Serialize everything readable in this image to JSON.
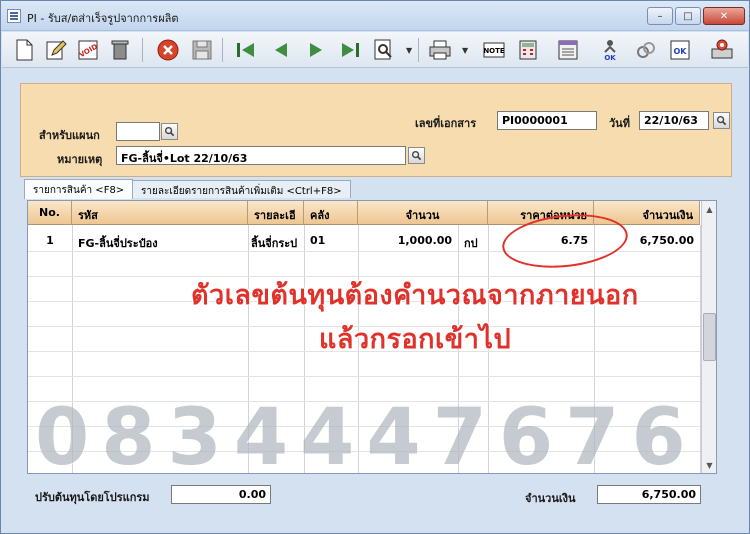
{
  "window": {
    "title": "PI - รับส/ตส่าเร็จรูปจากการผลิต",
    "min_label": "–",
    "max_label": "□",
    "close_label": "✕"
  },
  "toolbar": {
    "icons": [
      "new-icon",
      "edit-icon",
      "void-icon",
      "delete-icon",
      "cancel-icon",
      "save-icon",
      "first-icon",
      "prev-icon",
      "next-icon",
      "last-icon",
      "search-icon",
      "print-icon",
      "note-icon",
      "calculator-icon",
      "report-icon",
      "approve-ok-icon",
      "unlink-icon",
      "ok-icon",
      "settings-icon"
    ]
  },
  "form": {
    "department_label": "สำหรับแผนก",
    "department_value": "",
    "doc_no_label": "เลขที่เอกสาร",
    "doc_no_value": "PI0000001",
    "date_label": "วันที่",
    "date_value": "22/10/63",
    "remark_label": "หมายเหตุ",
    "remark_value": "FG-ลิ้นจี่•Lot 22/10/63"
  },
  "tabs": [
    {
      "label": "รายการสินค้า <F8>",
      "active": true
    },
    {
      "label": "รายละเอียดรายการสินค้าเพิ่มเติม <Ctrl+F8>",
      "active": false
    }
  ],
  "grid": {
    "columns": [
      "No.",
      "รหัส",
      "รายละเอี",
      "คลัง",
      "จำนวน",
      "ราคาต่อหน่วย",
      "จำนวนเงิน"
    ],
    "rows": [
      {
        "no": "1",
        "code": "FG-ลิ้นจี่ประป๋อง",
        "desc": "ลิ้นจี่กระป",
        "wh": "01",
        "qty": "1,000.00",
        "unit": "กป",
        "price": "6.75",
        "amount": "6,750.00"
      }
    ]
  },
  "annotation": {
    "line1": "ตัวเลขต้นทุนต้องคำนวณจากภายนอก",
    "line2": "แล้วกรอกเข้าไป"
  },
  "watermark": "0834447676",
  "footer": {
    "adjust_label": "ปรับต้นทุนโดยโปรแกรม",
    "adjust_value": "0.00",
    "total_label": "จำนวนเงิน",
    "total_value": "6,750.00"
  },
  "colors": {
    "panel_bg": "#f7dcb0",
    "grid_header": "#eec692",
    "annotation_red": "#e0312a",
    "window_bg": "#d4e1f1"
  }
}
